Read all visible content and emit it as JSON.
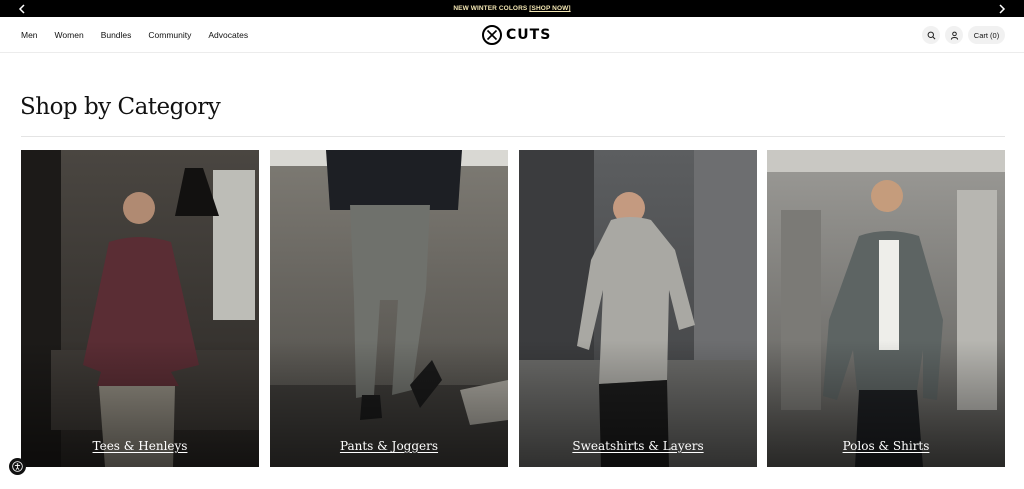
{
  "announcement": {
    "text": "NEW WINTER COLORS",
    "link": "[SHOP NOW]",
    "prev_icon": "chevron-left-icon",
    "next_icon": "chevron-right-icon"
  },
  "header": {
    "nav": [
      "Men",
      "Women",
      "Bundles",
      "Community",
      "Advocates"
    ],
    "logo_text": "CUTS",
    "search_icon": "search-icon",
    "account_icon": "user-icon",
    "cart_label": "Cart (0)"
  },
  "main": {
    "title": "Shop by Category",
    "categories": [
      {
        "label": "Tees & Henleys"
      },
      {
        "label": "Pants & Joggers"
      },
      {
        "label": "Sweatshirts & Layers"
      },
      {
        "label": "Polos & Shirts"
      }
    ]
  },
  "accessibility": {
    "icon": "accessibility-icon"
  },
  "colors": {
    "announcement_bg": "#000000",
    "announcement_text": "#f3e6b3",
    "button_bg": "#f1f1f1"
  }
}
